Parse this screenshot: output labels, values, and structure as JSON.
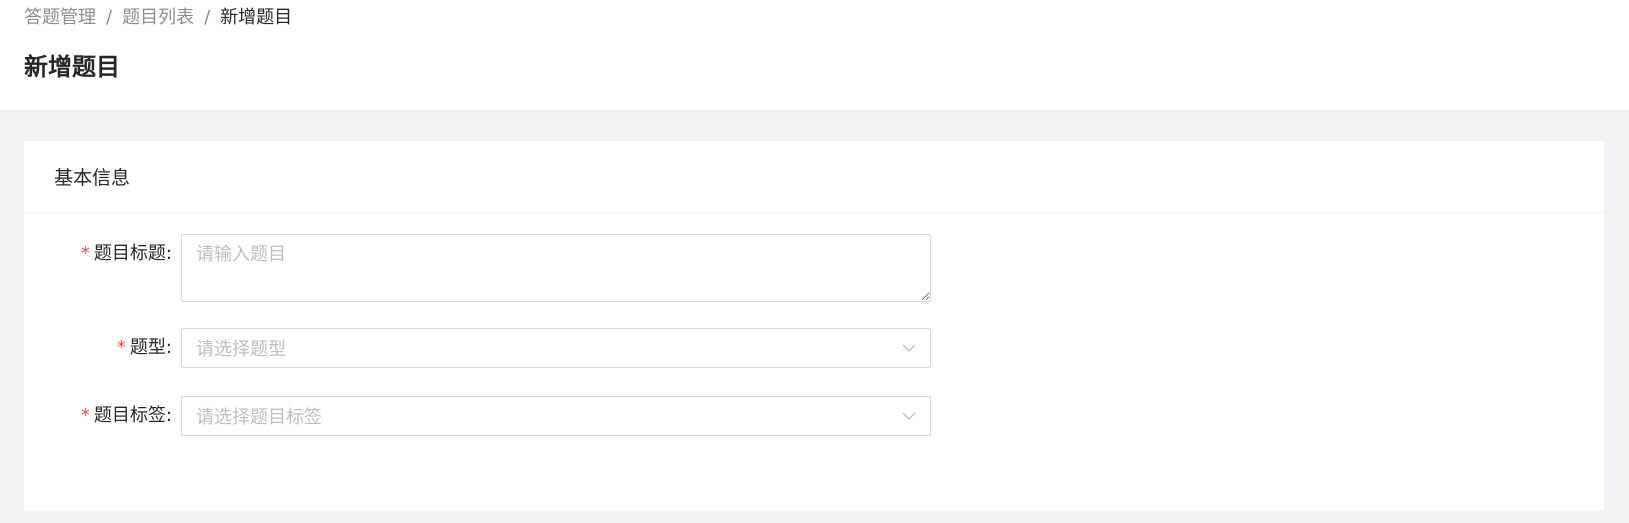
{
  "breadcrumb": {
    "items": [
      "答题管理",
      "题目列表",
      "新增题目"
    ],
    "separator": "/"
  },
  "page": {
    "title": "新增题目"
  },
  "card": {
    "title": "基本信息"
  },
  "form": {
    "required_mark": "*",
    "colon": ":",
    "fields": [
      {
        "label": "题目标题",
        "type": "textarea",
        "placeholder": "请输入题目",
        "value": ""
      },
      {
        "label": "题型",
        "type": "select",
        "placeholder": "请选择题型",
        "value": ""
      },
      {
        "label": "题目标签",
        "type": "select",
        "placeholder": "请选择题目标签",
        "value": ""
      }
    ]
  },
  "colors": {
    "required": "#ff4d4f",
    "border": "#d9d9d9",
    "placeholder": "#bfbfbf",
    "background": "#f0f2f5"
  },
  "icons": {
    "select_arrow": "chevron-down-icon"
  }
}
